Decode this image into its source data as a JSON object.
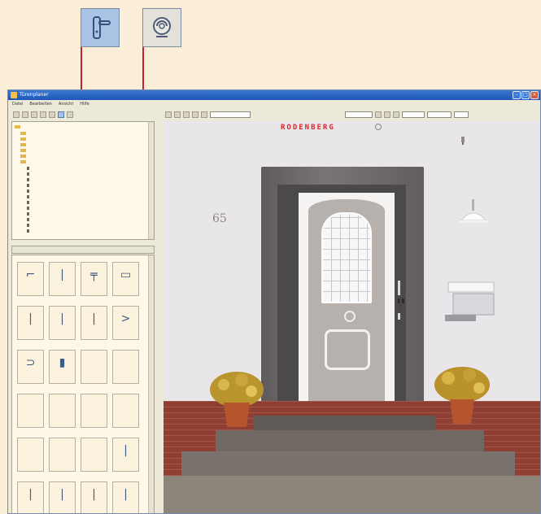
{
  "callouts": {
    "handle_icon": "door-handle-icon",
    "glass_icon": "glass-ornament-icon",
    "line_color": "#c0242d"
  },
  "window": {
    "title": "Türenplaner",
    "menu": [
      "Datei",
      "Bearbeiten",
      "Ansicht",
      "Hilfe"
    ]
  },
  "scene": {
    "brand": "RODENBERG",
    "house_number": "65",
    "wall_color": "#e9e6ea",
    "frame_color": "#6e6869",
    "door_color": "#b7b1ad"
  }
}
